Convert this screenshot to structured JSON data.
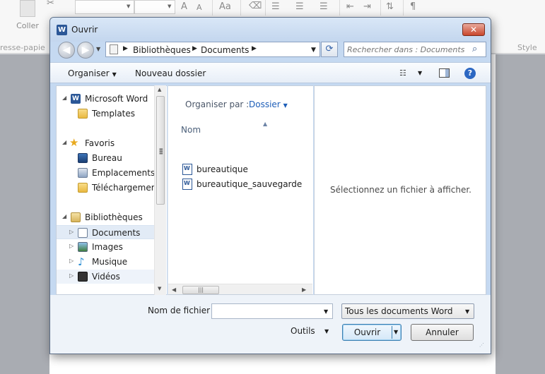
{
  "ribbon": {
    "paste_label": "Coller",
    "clipboard_group": "resse-papie",
    "style_group": "Style",
    "font_grow": "A",
    "font_shrink": "A",
    "font_case": "Aa",
    "paragraph_mark": "¶"
  },
  "dialog": {
    "title": "Ouvrir",
    "title_icon": "W",
    "close_glyph": "✕"
  },
  "address": {
    "breadcrumbs": [
      "Bibliothèques",
      "Documents"
    ],
    "search_placeholder": "Rechercher dans : Documents"
  },
  "toolbar": {
    "organize": "Organiser",
    "new_folder": "Nouveau dossier",
    "help": "?"
  },
  "nav": {
    "items": [
      {
        "label": "Microsoft Word",
        "icon": "word-icon",
        "level": 0,
        "expanded": true
      },
      {
        "label": "Templates",
        "icon": "folder-icon",
        "level": 1
      },
      {
        "label": "Favoris",
        "icon": "star-icon",
        "level": 0,
        "expanded": true
      },
      {
        "label": "Bureau",
        "icon": "desktop-icon",
        "level": 1
      },
      {
        "label": "Emplacements ré",
        "icon": "recent-places-icon",
        "level": 1
      },
      {
        "label": "Téléchargements",
        "icon": "downloads-icon",
        "level": 1
      },
      {
        "label": "Bibliothèques",
        "icon": "libraries-icon",
        "level": 0,
        "expanded": true
      },
      {
        "label": "Documents",
        "icon": "documents-icon",
        "level": 1,
        "selected": true
      },
      {
        "label": "Images",
        "icon": "images-icon",
        "level": 1
      },
      {
        "label": "Musique",
        "icon": "music-icon",
        "level": 1
      },
      {
        "label": "Vidéos",
        "icon": "videos-icon",
        "level": 1,
        "hover": true
      }
    ]
  },
  "files": {
    "arrange_label": "Organiser par :",
    "arrange_value": "Dossier",
    "column_name": "Nom",
    "items": [
      "bureautique",
      "bureautique_sauvegarde"
    ]
  },
  "preview": {
    "message": "Sélectionnez un fichier à afficher."
  },
  "bottom": {
    "filename_label": "Nom de fichier :",
    "filename_value": "",
    "filetype_value": "Tous les documents Word",
    "tools_label": "Outils",
    "open_label": "Ouvrir",
    "cancel_label": "Annuler"
  },
  "colors": {
    "dialog_frame": "#c5d9f1",
    "close_button": "#c9462c",
    "link_blue": "#1d5eb8",
    "word_blue": "#2b5797"
  }
}
